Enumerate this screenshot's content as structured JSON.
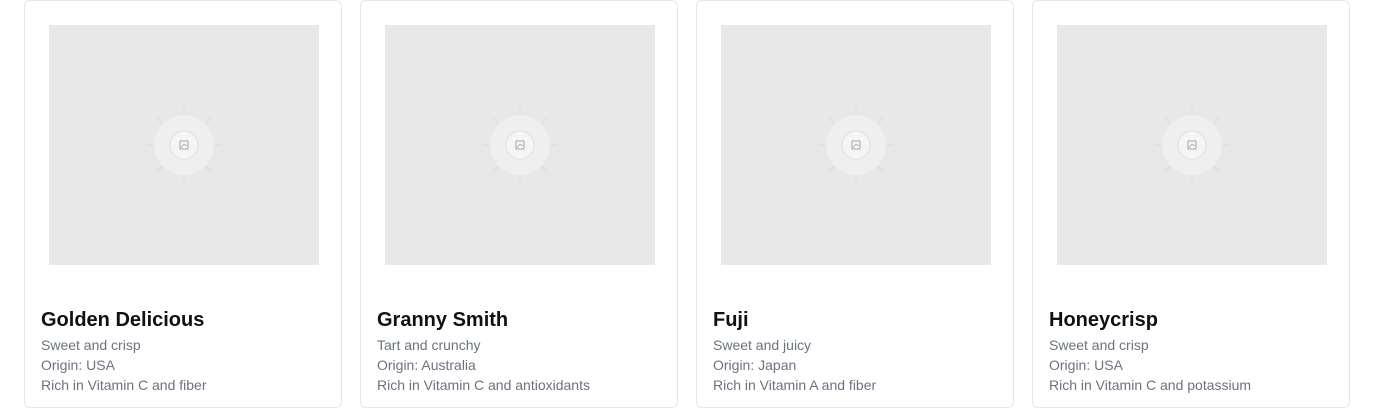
{
  "apples": [
    {
      "name": "Golden Delicious",
      "description": "Sweet and crisp",
      "origin": "Origin: USA",
      "nutrition": "Rich in Vitamin C and fiber",
      "image_icon": "broken-image-icon"
    },
    {
      "name": "Granny Smith",
      "description": "Tart and crunchy",
      "origin": "Origin: Australia",
      "nutrition": "Rich in Vitamin C and antioxidants",
      "image_icon": "broken-image-icon"
    },
    {
      "name": "Fuji",
      "description": "Sweet and juicy",
      "origin": "Origin: Japan",
      "nutrition": "Rich in Vitamin A and fiber",
      "image_icon": "broken-image-icon"
    },
    {
      "name": "Honeycrisp",
      "description": "Sweet and crisp",
      "origin": "Origin: USA",
      "nutrition": "Rich in Vitamin C and potassium",
      "image_icon": "broken-image-icon"
    }
  ],
  "colors": {
    "placeholder_bg": "#e8e8e8",
    "title": "#111111",
    "muted_text": "#6b7280",
    "card_border": "#e5e7eb"
  }
}
